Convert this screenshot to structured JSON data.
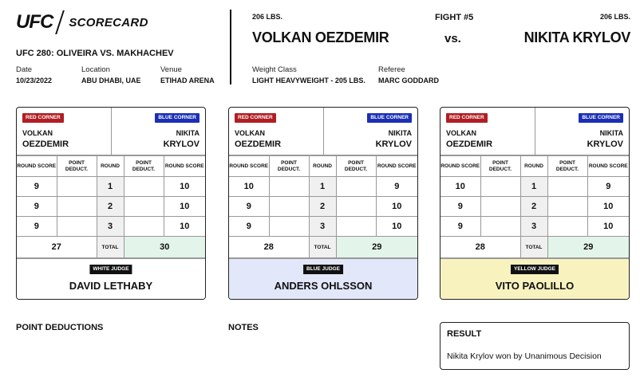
{
  "header": {
    "logo": "UFC",
    "title": "SCORECARD",
    "event": "UFC 280: OLIVEIRA VS. MAKHACHEV",
    "meta": [
      {
        "label": "Date",
        "value": "10/23/2022"
      },
      {
        "label": "Location",
        "value": "ABU DHABI, UAE"
      },
      {
        "label": "Venue",
        "value": "ETIHAD ARENA"
      }
    ]
  },
  "fight": {
    "number": "FIGHT #5",
    "vs": "vs.",
    "red": {
      "weight": "206 LBS.",
      "name": "VOLKAN OEZDEMIR",
      "first": "VOLKAN",
      "last": "OEZDEMIR"
    },
    "blue": {
      "weight": "206 LBS.",
      "name": "NIKITA KRYLOV",
      "first": "NIKITA",
      "last": "KRYLOV"
    },
    "weight_class_label": "Weight Class",
    "weight_class": "LIGHT HEAVYWEIGHT - 205 LBS.",
    "referee_label": "Referee",
    "referee": "MARC GODDARD"
  },
  "table_labels": {
    "red_corner": "RED CORNER",
    "blue_corner": "BLUE CORNER",
    "round_score": "ROUND SCORE",
    "point_deduct": "POINT DEDUCT.",
    "round": "ROUND",
    "total": "TOTAL"
  },
  "cards": [
    {
      "judge_tag": "WHITE JUDGE",
      "judge_name": "DAVID LETHABY",
      "bg": "#ffffff",
      "rounds": [
        {
          "red": "9",
          "red_ded": "",
          "round": "1",
          "blue_ded": "",
          "blue": "10"
        },
        {
          "red": "9",
          "red_ded": "",
          "round": "2",
          "blue_ded": "",
          "blue": "10"
        },
        {
          "red": "9",
          "red_ded": "",
          "round": "3",
          "blue_ded": "",
          "blue": "10"
        }
      ],
      "red_total": "27",
      "blue_total": "30"
    },
    {
      "judge_tag": "BLUE JUDGE",
      "judge_name": "ANDERS OHLSSON",
      "bg": "#e3e7fa",
      "rounds": [
        {
          "red": "10",
          "red_ded": "",
          "round": "1",
          "blue_ded": "",
          "blue": "9"
        },
        {
          "red": "9",
          "red_ded": "",
          "round": "2",
          "blue_ded": "",
          "blue": "10"
        },
        {
          "red": "9",
          "red_ded": "",
          "round": "3",
          "blue_ded": "",
          "blue": "10"
        }
      ],
      "red_total": "28",
      "blue_total": "29"
    },
    {
      "judge_tag": "YELLOW JUDGE",
      "judge_name": "VITO PAOLILLO",
      "bg": "#f8f2bf",
      "rounds": [
        {
          "red": "10",
          "red_ded": "",
          "round": "1",
          "blue_ded": "",
          "blue": "9"
        },
        {
          "red": "9",
          "red_ded": "",
          "round": "2",
          "blue_ded": "",
          "blue": "10"
        },
        {
          "red": "9",
          "red_ded": "",
          "round": "3",
          "blue_ded": "",
          "blue": "10"
        }
      ],
      "red_total": "28",
      "blue_total": "29"
    }
  ],
  "footer": {
    "point_deductions": "POINT DEDUCTIONS",
    "notes": "NOTES",
    "result_title": "RESULT",
    "result_text": "Nikita Krylov won by Unanimous Decision"
  }
}
